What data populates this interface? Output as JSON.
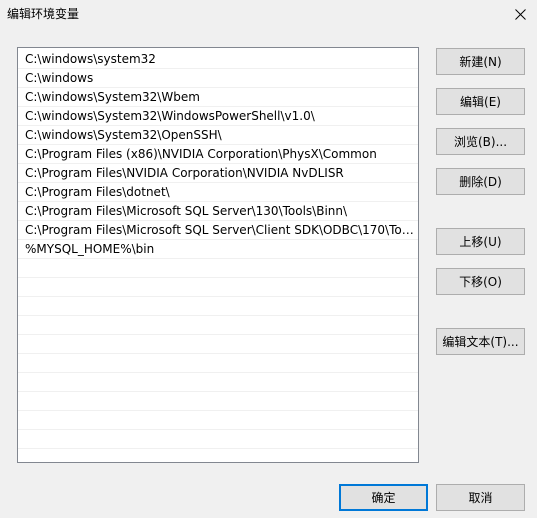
{
  "window": {
    "title": "编辑环境变量"
  },
  "path_list": {
    "items": [
      "C:\\windows\\system32",
      "C:\\windows",
      "C:\\windows\\System32\\Wbem",
      "C:\\windows\\System32\\WindowsPowerShell\\v1.0\\",
      "C:\\windows\\System32\\OpenSSH\\",
      "C:\\Program Files (x86)\\NVIDIA Corporation\\PhysX\\Common",
      "C:\\Program Files\\NVIDIA Corporation\\NVIDIA NvDLISR",
      "C:\\Program Files\\dotnet\\",
      "C:\\Program Files\\Microsoft SQL Server\\130\\Tools\\Binn\\",
      "C:\\Program Files\\Microsoft SQL Server\\Client SDK\\ODBC\\170\\Too...",
      "%MYSQL_HOME%\\bin",
      "",
      "",
      "",
      "",
      "",
      "",
      "",
      "",
      "",
      "",
      ""
    ]
  },
  "buttons": {
    "new": "新建(N)",
    "edit": "编辑(E)",
    "browse": "浏览(B)...",
    "delete": "删除(D)",
    "move_up": "上移(U)",
    "move_down": "下移(O)",
    "edit_text": "编辑文本(T)...",
    "ok": "确定",
    "cancel": "取消"
  },
  "colors": {
    "background": "#f0f0f0",
    "list_border": "#828790",
    "button_face": "#e1e1e1",
    "default_button_border": "#0078d7"
  }
}
